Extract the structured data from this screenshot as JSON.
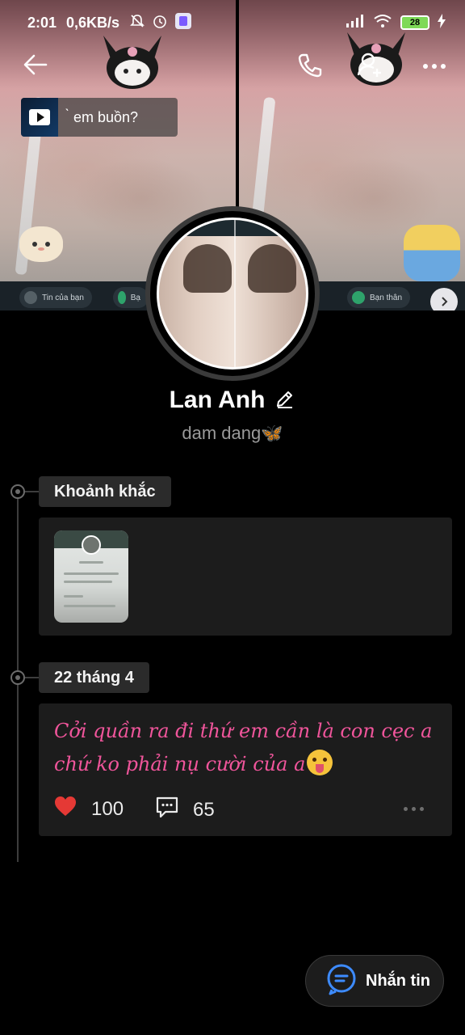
{
  "status_bar": {
    "time": "2:01",
    "network_speed": "0,6KB/s",
    "battery_level": "28",
    "icons": [
      "mute-icon",
      "alarm-icon",
      "app-notification-icon",
      "signal-icon",
      "wifi-icon",
      "battery-icon",
      "charging-icon"
    ]
  },
  "header": {
    "back_icon": "arrow-left-icon",
    "call_icon": "phone-icon",
    "add_friend_icon": "add-friend-icon",
    "more_icon": "more-horizontal-icon"
  },
  "cover": {
    "music_text": "̀ em buồn?",
    "chips": [
      {
        "label": "Tin của bạn"
      },
      {
        "label": "Bạ"
      },
      {
        "label": "Bạn thân"
      }
    ]
  },
  "profile": {
    "name": "Lan Anh",
    "bio": "dam dang🦋"
  },
  "timeline": {
    "sections": [
      {
        "label": "Khoảnh khắc"
      },
      {
        "label": "22 tháng 4"
      }
    ]
  },
  "post": {
    "text": "Cởi quần ra đi thứ em cần là con cẹc a chứ ko phải nụ cười của a",
    "likes": "100",
    "comments": "65"
  },
  "message_button": {
    "label": "Nhắn tin"
  },
  "colors": {
    "background": "#000000",
    "card": "#1c1c1c",
    "post_text": "#f0559b",
    "accent_blue": "#3d8bff",
    "heart": "#e53935"
  }
}
